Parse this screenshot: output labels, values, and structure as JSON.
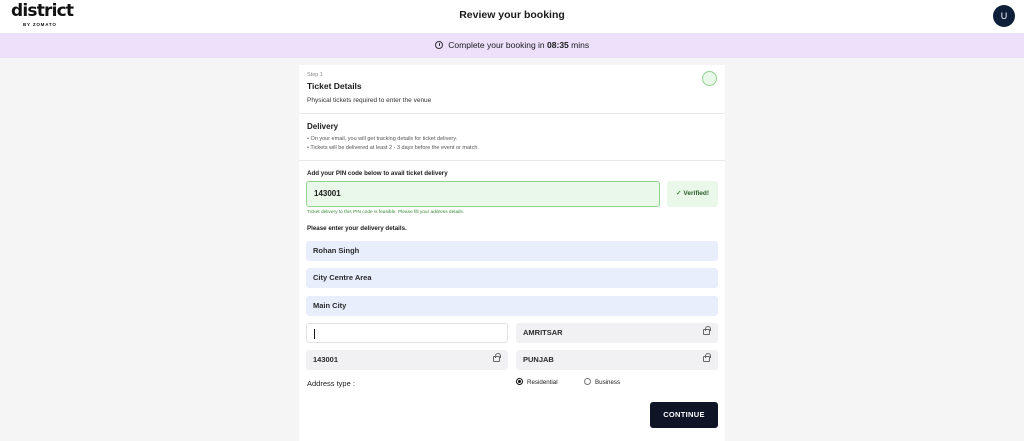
{
  "header": {
    "logo_text": "district",
    "logo_sub": "BY ZOMATO",
    "title": "Review your booking",
    "avatar_initial": "U"
  },
  "timer": {
    "prefix": "Complete your booking in",
    "value": "08:35",
    "suffix": "mins"
  },
  "step": {
    "label": "Step 1",
    "title": "Ticket Details",
    "subtitle": "Physical tickets required to enter the venue"
  },
  "delivery": {
    "title": "Delivery",
    "bullets": [
      "On your email, you will get tracking details for ticket delivery.",
      "Tickets will be delivered at least 2 - 3 days before the event or match."
    ]
  },
  "pin": {
    "label": "Add your PIN code below to avail ticket delivery",
    "value": "143001",
    "verified_label": "Verified!",
    "hint": "Ticket delivery to this PIN code is feasible. Please fill your address details."
  },
  "address": {
    "label": "Please enter your delivery details.",
    "name": "Rohan Singh",
    "line1": "City Centre Area",
    "line2": "Main City",
    "line3": "",
    "city": "AMRITSAR",
    "pincode": "143001",
    "state": "PUNJAB",
    "type_label": "Address type :",
    "type_options": [
      "Residential",
      "Business"
    ],
    "type_selected": "Residential"
  },
  "actions": {
    "continue_label": "CONTINUE"
  },
  "colors": {
    "accent_banner": "#ece0fb",
    "verified_green": "#8fd48f",
    "input_blue": "#e8eefc",
    "button_dark": "#0f1526"
  }
}
